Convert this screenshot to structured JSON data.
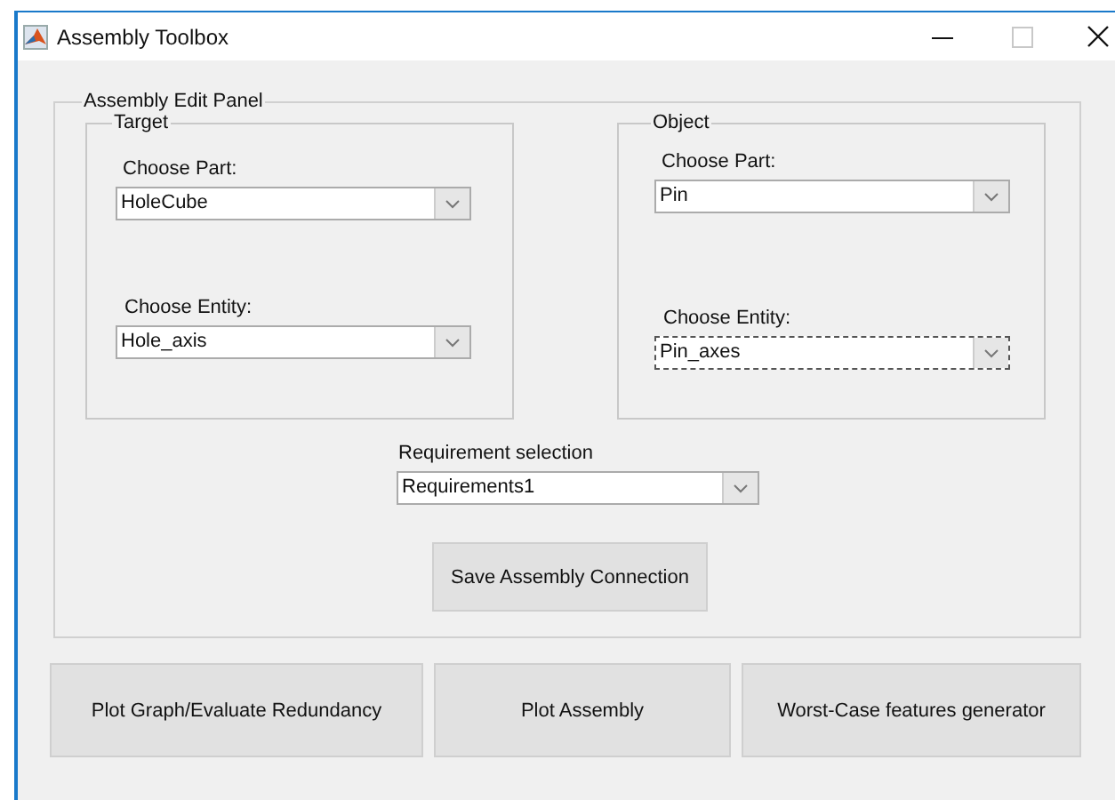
{
  "window": {
    "title": "Assembly Toolbox"
  },
  "panel": {
    "title": "Assembly Edit Panel",
    "groups": [
      {
        "title": "Target",
        "part_label": "Choose Part:",
        "part_value": "HoleCube",
        "entity_label": "Choose Entity:",
        "entity_value": "Hole_axis",
        "entity_focused": false
      },
      {
        "title": "Object",
        "part_label": "Choose Part:",
        "part_value": "Pin",
        "entity_label": "Choose Entity:",
        "entity_value": "Pin_axes",
        "entity_focused": true
      }
    ],
    "requirement": {
      "label": "Requirement selection",
      "value": "Requirements1"
    },
    "save_button": "Save Assembly Connection"
  },
  "buttons": [
    "Plot Graph/Evaluate Redundancy",
    "Plot Assembly",
    "Worst-Case features generator"
  ]
}
